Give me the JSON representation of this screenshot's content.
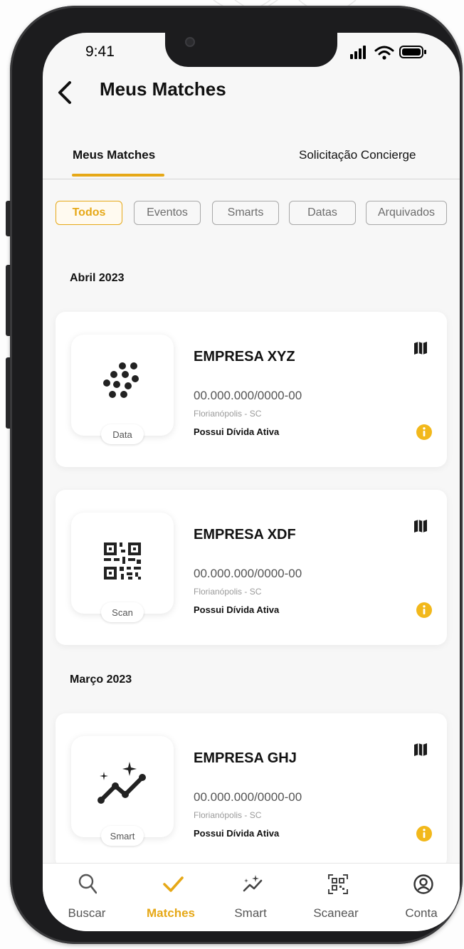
{
  "status_bar": {
    "time": "9:41"
  },
  "header": {
    "title": "Meus Matches"
  },
  "tabs": [
    {
      "label": "Meus Matches",
      "active": true
    },
    {
      "label": "Solicitação Concierge",
      "active": false
    }
  ],
  "filters": [
    {
      "label": "Todos",
      "active": true
    },
    {
      "label": "Eventos",
      "active": false
    },
    {
      "label": "Smarts",
      "active": false
    },
    {
      "label": "Datas",
      "active": false
    },
    {
      "label": "Arquivados",
      "active": false
    }
  ],
  "sections": [
    {
      "label": "Abril 2023",
      "cards": [
        {
          "name": "EMPRESA XYZ",
          "document": "00.000.000/0000-00",
          "city": "Florianópolis - SC",
          "status": "Possui Dívida Ativa",
          "badge": "Data",
          "icon": "dots-icon"
        },
        {
          "name": "EMPRESA XDF",
          "document": "00.000.000/0000-00",
          "city": "Florianópolis - SC",
          "status": "Possui Dívida Ativa",
          "badge": "Scan",
          "icon": "qr-code-icon"
        }
      ]
    },
    {
      "label": "Março 2023",
      "cards": [
        {
          "name": "EMPRESA GHJ",
          "document": "00.000.000/0000-00",
          "city": "Florianópolis - SC",
          "status": "Possui Dívida Ativa",
          "badge": "Smart",
          "icon": "sparkle-trend-icon"
        }
      ]
    }
  ],
  "bottom_nav": [
    {
      "label": "Buscar",
      "icon": "search-icon",
      "active": false
    },
    {
      "label": "Matches",
      "icon": "check-icon",
      "active": true
    },
    {
      "label": "Smart",
      "icon": "sparkle-trend-icon",
      "active": false
    },
    {
      "label": "Scanear",
      "icon": "qr-scan-icon",
      "active": false
    },
    {
      "label": "Conta",
      "icon": "account-icon",
      "active": false
    }
  ],
  "colors": {
    "accent": "#e6a817",
    "text": "#111111",
    "muted": "#9a9a9a",
    "background": "#f7f7f7"
  }
}
